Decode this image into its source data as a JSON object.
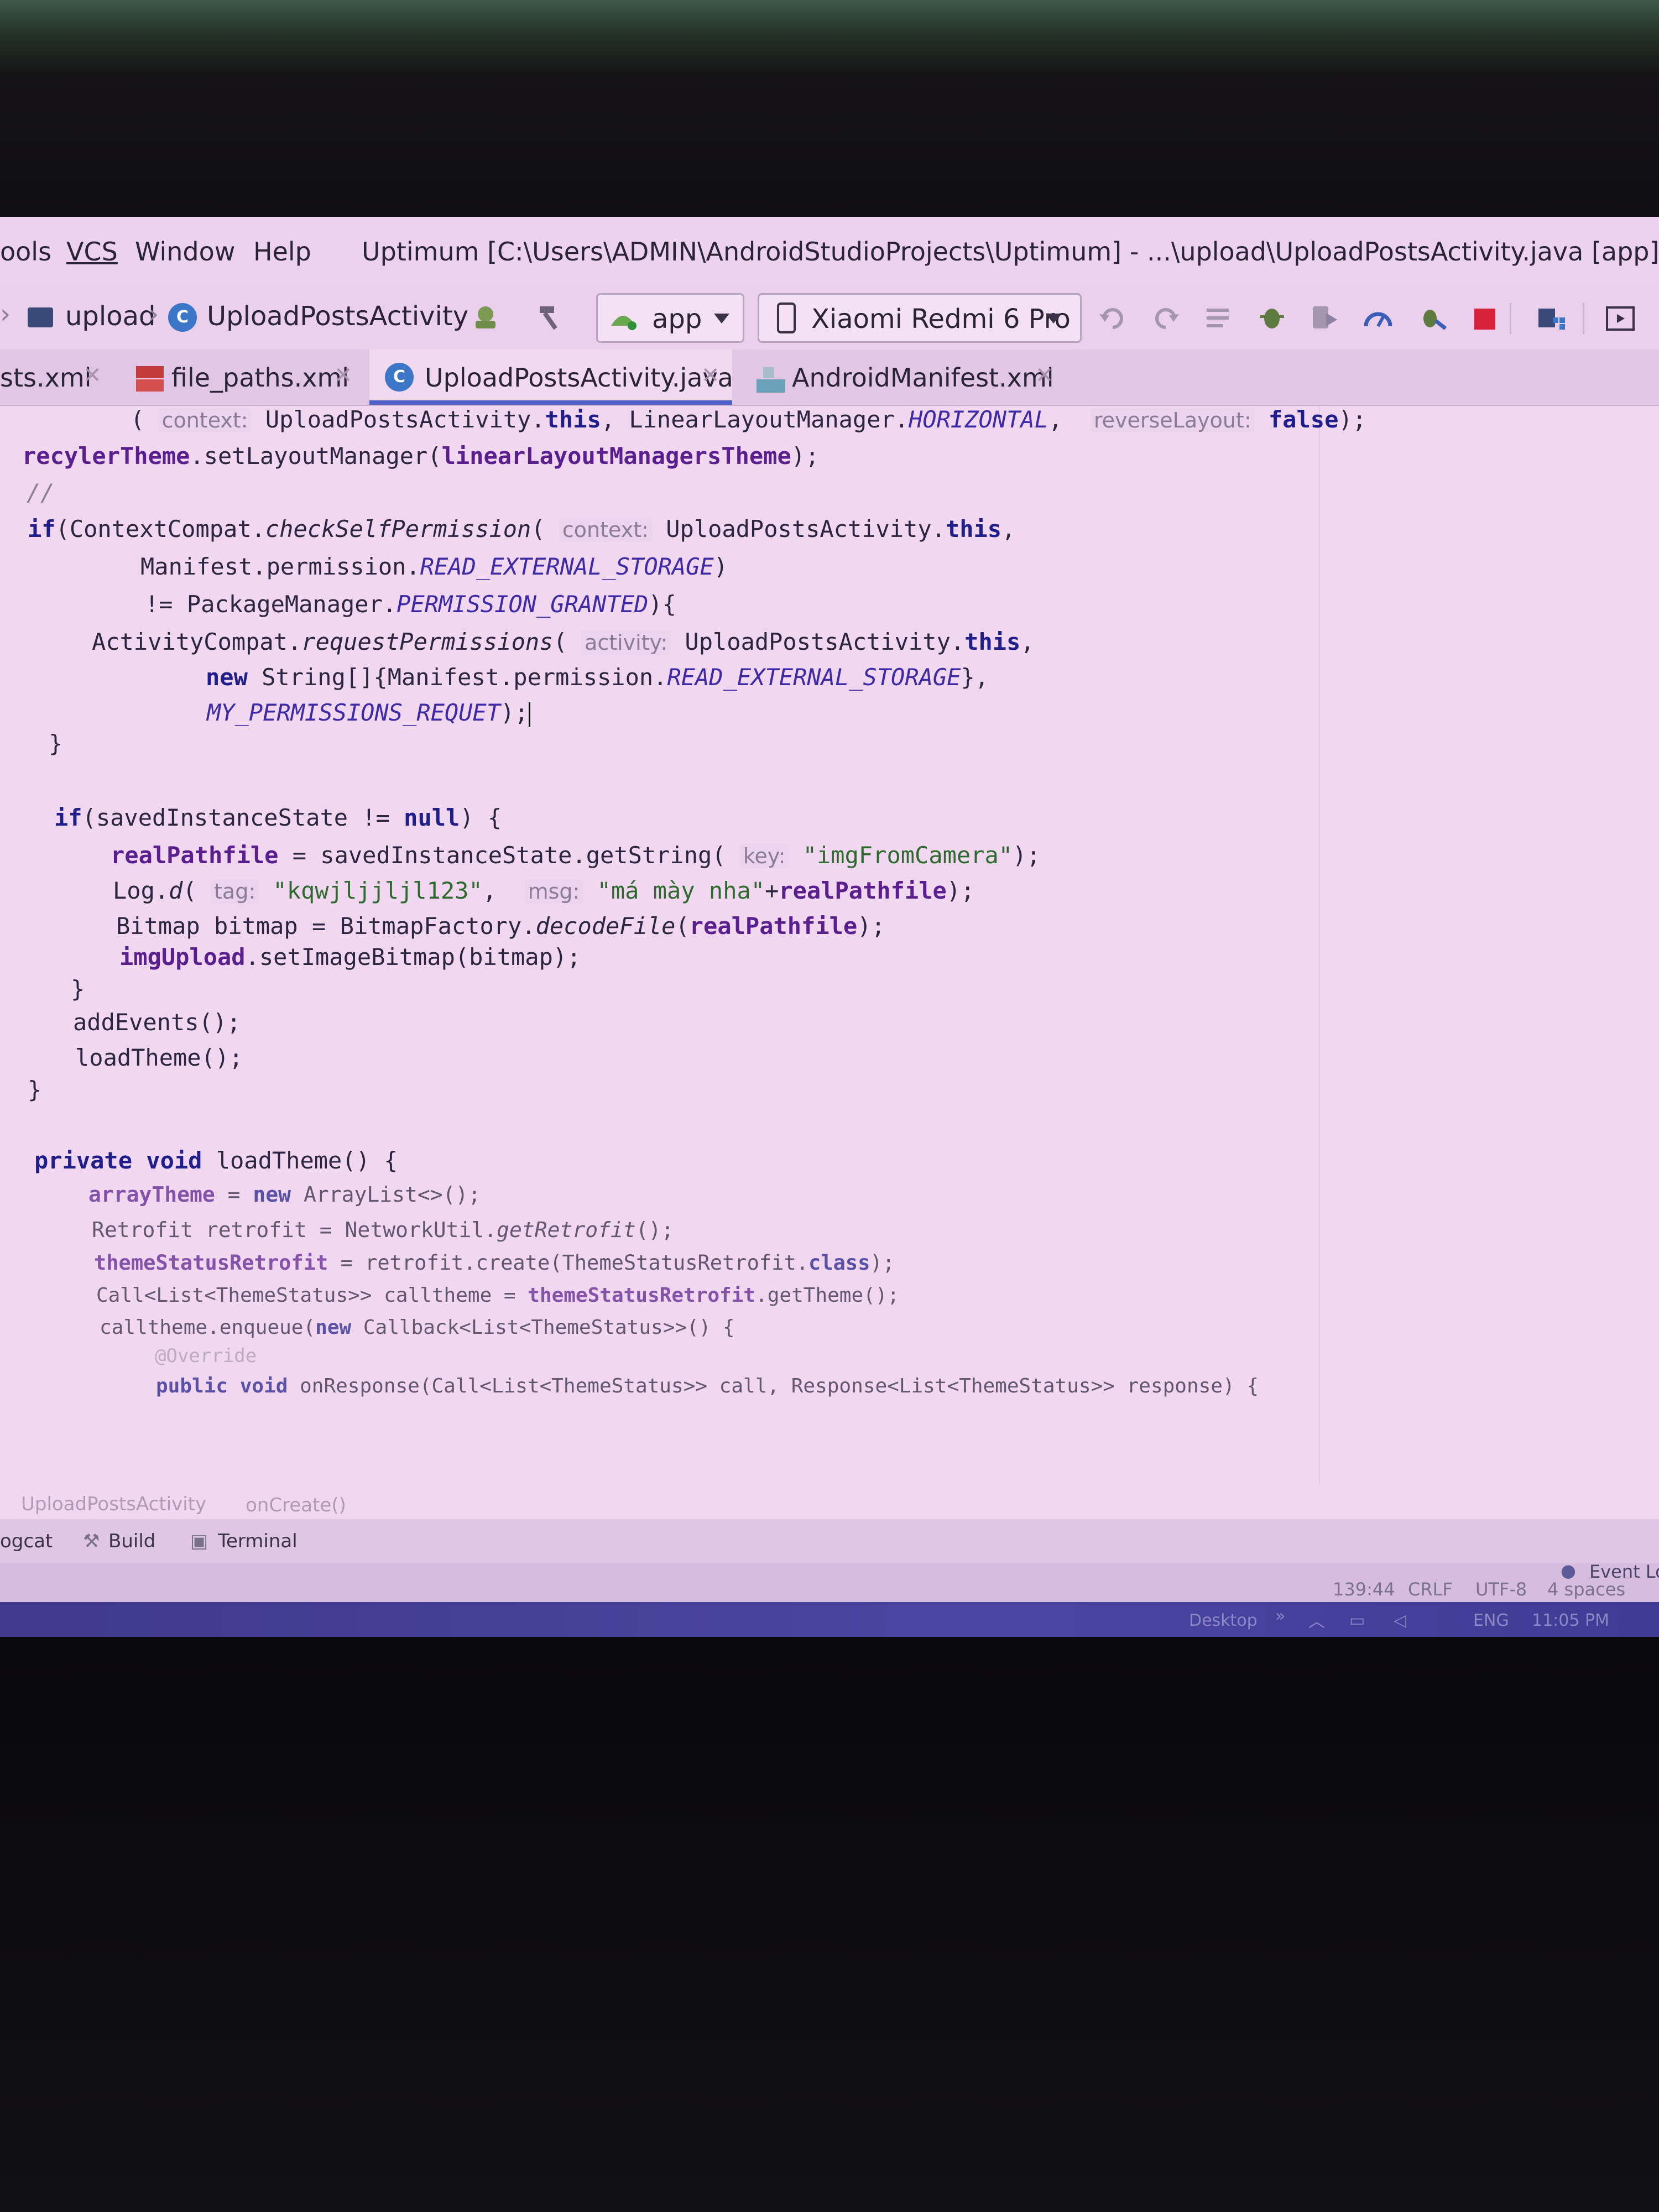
{
  "menu": {
    "items": [
      "ools",
      "VCS",
      "Window",
      "Help"
    ],
    "title": "Uptimum [C:\\Users\\ADMIN\\AndroidStudioProjects\\Uptimum] - ...\\upload\\UploadPostsActivity.java [app]"
  },
  "toolbar": {
    "breadcrumb_folder": "upload",
    "breadcrumb_class": "UploadPostsActivity",
    "class_icon_letter": "C",
    "run_config": "app",
    "device": "Xiaomi Redmi 6 Pro",
    "icons": [
      "attach-debugger-icon",
      "build-hammer-icon",
      "android-icon",
      "device-icon",
      "rerun-icon",
      "apply-changes-icon",
      "coverage-icon",
      "debug-icon",
      "profile-icon",
      "profiler-gauge-icon",
      "attach-icon",
      "stop-icon",
      "project-structure-icon",
      "avd-manager-icon"
    ],
    "accent_stop": "#d8203a"
  },
  "tabs": [
    {
      "label": "sts.xml",
      "active": false
    },
    {
      "label": "file_paths.xml",
      "active": false
    },
    {
      "label": "UploadPostsActivity.java",
      "active": true
    },
    {
      "label": "AndroidManifest.xml",
      "active": false
    }
  ],
  "editor": {
    "l01_open": "( ",
    "l01_hint_context": "context:",
    "l01_a": " UploadPostsActivity.",
    "l01_this": "this",
    "l01_b": ", LinearLayoutManager.",
    "l01_horizontal": "HORIZONTAL",
    "l01_c": ",  ",
    "l01_hint_reverse": "reverseLayout:",
    "l01_false": " false",
    "l01_d": ");",
    "l02_field": "recylerTheme",
    "l02_a": ".setLayoutManager(",
    "l02_field2": "linearLayoutManagersTheme",
    "l02_b": ");",
    "l03_comment": "//",
    "l04_if": "if",
    "l04_a": "(ContextCompat.",
    "l04_method": "checkSelfPermission",
    "l04_b": "( ",
    "l04_hint": "context:",
    "l04_c": " UploadPostsActivity.",
    "l04_this": "this",
    "l04_d": ",",
    "l05_a": "Manifest.permission.",
    "l05_const": "READ_EXTERNAL_STORAGE",
    "l05_b": ")",
    "l06_a": "!= PackageManager.",
    "l06_const": "PERMISSION_GRANTED",
    "l06_b": "){",
    "l07_a": "ActivityCompat.",
    "l07_method": "requestPermissions",
    "l07_b": "( ",
    "l07_hint": "activity:",
    "l07_c": " UploadPostsActivity.",
    "l07_this": "this",
    "l07_d": ",",
    "l08_new": "new",
    "l08_a": " String[]{Manifest.permission.",
    "l08_const": "READ_EXTERNAL_STORAGE",
    "l08_b": "},",
    "l09_const": "MY_PERMISSIONS_REQUET",
    "l09_a": ");",
    "l10": "}",
    "l11_if": "if",
    "l11_a": "(savedInstanceState != ",
    "l11_null": "null",
    "l11_b": ") {",
    "l12_field": "realPathfile",
    "l12_a": " = savedInstanceState.getString( ",
    "l12_hint": "key:",
    "l12_str": " \"imgFromCamera\"",
    "l12_b": ");",
    "l13_a": "Log.",
    "l13_method": "d",
    "l13_b": "( ",
    "l13_hint_tag": "tag:",
    "l13_str1": " \"kqwjljjljl123\"",
    "l13_c": ",  ",
    "l13_hint_msg": "msg:",
    "l13_str2": " \"má mày nha\"",
    "l13_d": "+",
    "l13_field": "realPathfile",
    "l13_e": ");",
    "l14_a": "Bitmap bitmap = BitmapFactory.",
    "l14_method": "decodeFile",
    "l14_b": "(",
    "l14_field": "realPathfile",
    "l14_c": ");",
    "l15_field": "imgUpload",
    "l15_a": ".setImageBitmap(bitmap);",
    "l16": "}",
    "l17": "addEvents();",
    "l18": "loadTheme();",
    "l19": "}",
    "l20_private": "private",
    "l20_void": " void",
    "l20_a": " loadTheme() {",
    "l21_field": "arrayTheme",
    "l21_a": " = ",
    "l21_new": "new",
    "l21_b": " ArrayList<>();",
    "l22_a": "Retrofit retrofit = NetworkUtil.",
    "l22_method": "getRetrofit",
    "l22_b": "();",
    "l23_field": "themeStatusRetrofit",
    "l23_a": " = retrofit.create(ThemeStatusRetrofit.",
    "l23_class": "class",
    "l23_b": ");",
    "l24_a": "Call<List<ThemeStatus>> calltheme = ",
    "l24_field": "themeStatusRetrofit",
    "l24_b": ".getTheme();",
    "l25_a": "calltheme.enqueue(",
    "l25_new": "new",
    "l25_b": " Callback<List<ThemeStatus>>() {",
    "l26_ann": "@Override",
    "l27_public": "public",
    "l27_void": " void",
    "l27_a": " onResponse(Call<List<ThemeStatus>> call, Response<List<ThemeStatus>> response) {"
  },
  "editor_footer": {
    "class": "UploadPostsActivity",
    "method": "onCreate()"
  },
  "toolwindows": {
    "logcat": "ogcat",
    "build": "Build",
    "terminal": "Terminal",
    "event_log": "Event Lo"
  },
  "status": {
    "position": "139:44",
    "line_sep": "CRLF",
    "encoding": "UTF-8",
    "indent": "4 spaces"
  },
  "taskbar": {
    "desktop": "Desktop",
    "chevron": "»",
    "lang": "ENG",
    "time": "11:05 PM"
  }
}
